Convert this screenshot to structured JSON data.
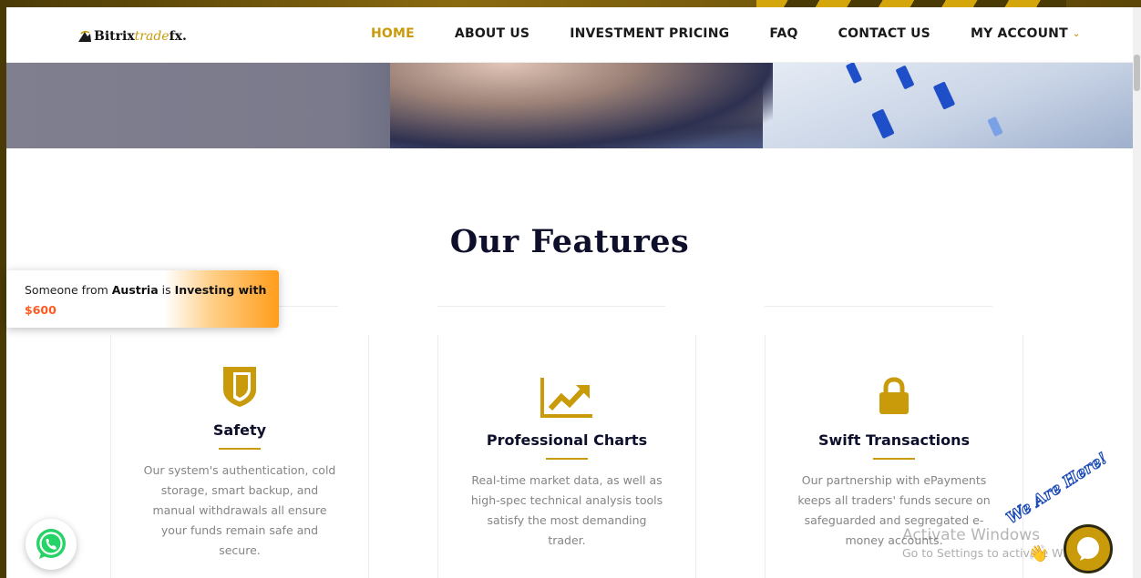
{
  "brand": {
    "name_part1": "Bitrix",
    "name_part2": "trade",
    "name_part3": "fx."
  },
  "nav": {
    "items": [
      {
        "label": "HOME",
        "active": true
      },
      {
        "label": "ABOUT US",
        "active": false
      },
      {
        "label": "INVESTMENT PRICING",
        "active": false
      },
      {
        "label": "FAQ",
        "active": false
      },
      {
        "label": "CONTACT US",
        "active": false
      },
      {
        "label": "MY ACCOUNT",
        "active": false,
        "has_dropdown": true
      }
    ]
  },
  "features": {
    "title": "Our Features",
    "cards": [
      {
        "icon": "shield-icon",
        "title": "Safety",
        "text": "Our system's authentication, cold storage, smart backup, and manual withdrawals all ensure your funds remain safe and secure."
      },
      {
        "icon": "chart-icon",
        "title": "Professional Charts",
        "text": "Real-time market data, as well as high-spec technical analysis tools satisfy the most demanding trader."
      },
      {
        "icon": "lock-icon",
        "title": "Swift Transactions",
        "text": "Our partnership with ePayments keeps all traders' funds secure on safeguarded and segregated e-money accounts."
      }
    ]
  },
  "notification": {
    "prefix": "Someone from ",
    "country": "Austria",
    "middle": " is ",
    "action": "Investing with",
    "amount": "$600"
  },
  "chat": {
    "badge_text": "We Are Here!"
  },
  "windows_watermark": {
    "line1": "Activate Windows",
    "line2": "Go to Settings to activate Windows."
  },
  "colors": {
    "accent": "#c99a0a",
    "heading": "#0d0f2b",
    "body_text": "#858585",
    "amount": "#ff5a1f",
    "whatsapp": "#25d366"
  }
}
